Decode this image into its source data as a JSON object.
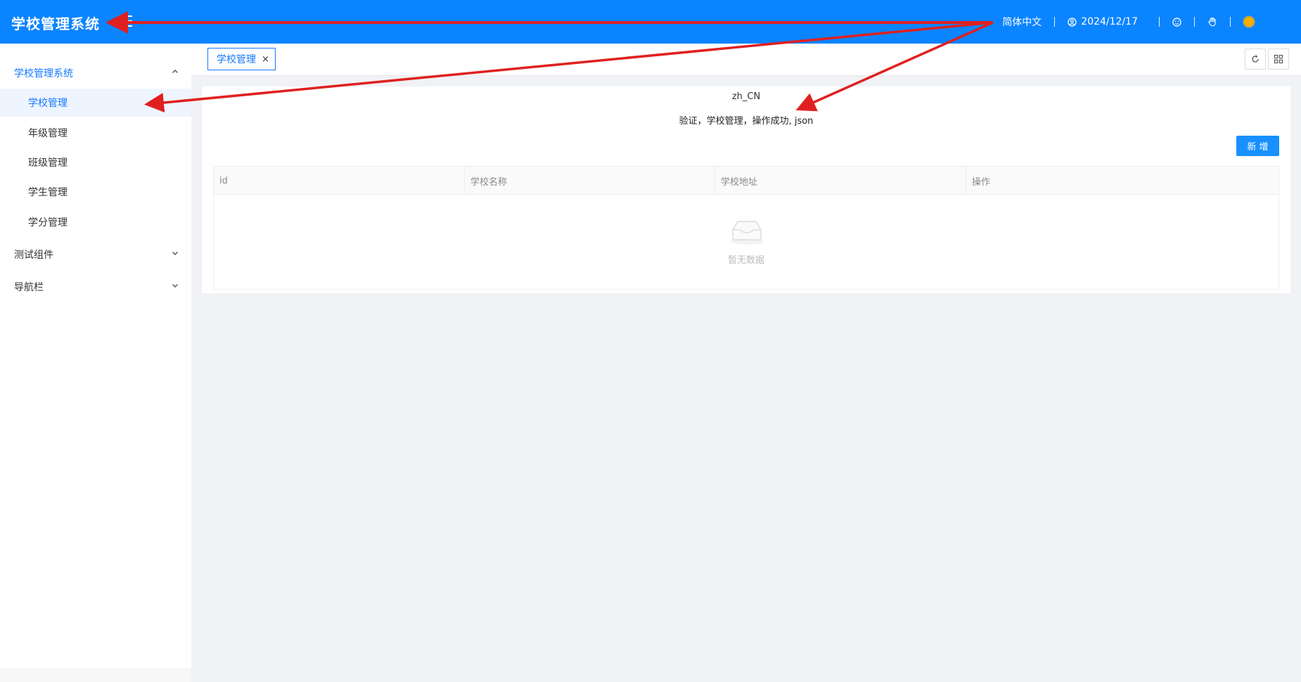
{
  "header": {
    "app_title": "学校管理系统",
    "language": "简体中文",
    "date": "2024/12/17"
  },
  "sidebar": {
    "group_school": {
      "label": "学校管理系统",
      "items": [
        {
          "label": "学校管理"
        },
        {
          "label": "年级管理"
        },
        {
          "label": "班级管理"
        },
        {
          "label": "学生管理"
        },
        {
          "label": "学分管理"
        }
      ]
    },
    "group_test": {
      "label": "测试组件"
    },
    "group_nav": {
      "label": "导航栏"
    }
  },
  "tabs": [
    {
      "label": "学校管理",
      "close": "×"
    }
  ],
  "main": {
    "locale": "zh_CN",
    "message": "验证，学校管理，操作成功, json",
    "add_button": "新 增",
    "table": {
      "columns": [
        "id",
        "学校名称",
        "学校地址",
        "操作"
      ],
      "rows": [],
      "empty_text": "暂无数据"
    }
  },
  "colors": {
    "header_bg": "#0a84ff",
    "accent": "#1677ff",
    "button": "#1890ff",
    "annotation_arrow": "#e02020"
  },
  "icons": {
    "menu": "menu-fold-icon",
    "user": "user-icon",
    "fullscreen": "smile-icon",
    "hand": "hand-icon",
    "theme": "sun-icon",
    "refresh": "refresh-icon",
    "layout": "grid-icon",
    "empty": "inbox-icon"
  }
}
